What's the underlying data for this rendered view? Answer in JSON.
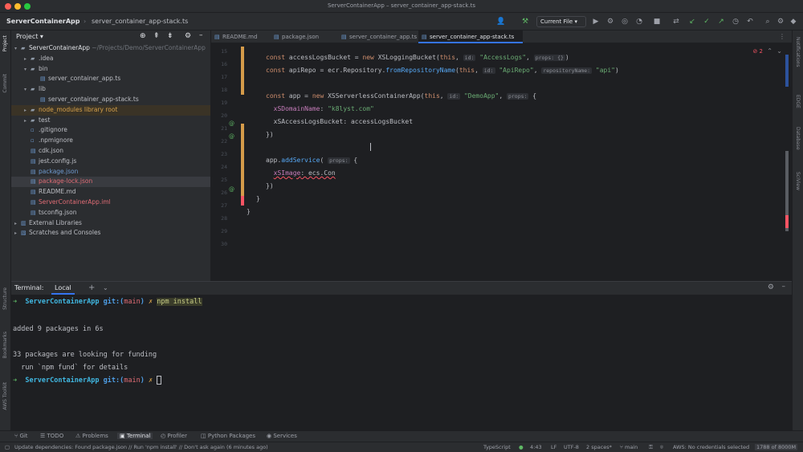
{
  "window": {
    "title": "ServerContainerApp – server_container_app-stack.ts"
  },
  "navbar": {
    "project": "ServerContainerApp",
    "breadcrumb": "server_container_app-stack.ts",
    "run_config": "Current File"
  },
  "project_panel": {
    "title": "Project",
    "items": [
      {
        "label": "ServerContainerApp",
        "suffix": "~/Projects/Demo/ServerContainerApp",
        "indent": 0,
        "arrow": "▾",
        "icon": "folder-icon",
        "color": "#dfe1e5"
      },
      {
        "label": ".idea",
        "indent": 1,
        "arrow": "▸",
        "icon": "folder-icon",
        "color": "#bcbec4"
      },
      {
        "label": "bin",
        "indent": 1,
        "arrow": "▾",
        "icon": "folder-icon",
        "color": "#bcbec4"
      },
      {
        "label": "server_container_app.ts",
        "indent": 2,
        "arrow": "",
        "icon": "ts-file-icon",
        "color": "#bcbec4"
      },
      {
        "label": "lib",
        "indent": 1,
        "arrow": "▾",
        "icon": "folder-icon",
        "color": "#bcbec4"
      },
      {
        "label": "server_container_app-stack.ts",
        "indent": 2,
        "arrow": "",
        "icon": "ts-file-icon",
        "color": "#bcbec4"
      },
      {
        "label": "node_modules  library root",
        "indent": 1,
        "arrow": "▸",
        "icon": "folder-icon",
        "color": "#d5a04a"
      },
      {
        "label": "test",
        "indent": 1,
        "arrow": "▸",
        "icon": "folder-icon",
        "color": "#bcbec4"
      },
      {
        "label": ".gitignore",
        "indent": 1,
        "arrow": "",
        "icon": "file-icon",
        "color": "#bcbec4"
      },
      {
        "label": ".npmignore",
        "indent": 1,
        "arrow": "",
        "icon": "file-icon",
        "color": "#bcbec4"
      },
      {
        "label": "cdk.json",
        "indent": 1,
        "arrow": "",
        "icon": "json-file-icon",
        "color": "#bcbec4"
      },
      {
        "label": "jest.config.js",
        "indent": 1,
        "arrow": "",
        "icon": "js-file-icon",
        "color": "#bcbec4"
      },
      {
        "label": "package.json",
        "indent": 1,
        "arrow": "",
        "icon": "json-file-icon",
        "color": "#6f9bd1"
      },
      {
        "label": "package-lock.json",
        "indent": 1,
        "arrow": "",
        "icon": "json-file-icon",
        "color": "#e06c75"
      },
      {
        "label": "README.md",
        "indent": 1,
        "arrow": "",
        "icon": "md-file-icon",
        "color": "#bcbec4"
      },
      {
        "label": "ServerContainerApp.iml",
        "indent": 1,
        "arrow": "",
        "icon": "iml-file-icon",
        "color": "#e06c75"
      },
      {
        "label": "tsconfig.json",
        "indent": 1,
        "arrow": "",
        "icon": "json-file-icon",
        "color": "#bcbec4"
      },
      {
        "label": "External Libraries",
        "indent": 0,
        "arrow": "▸",
        "icon": "library-icon",
        "color": "#bcbec4"
      },
      {
        "label": "Scratches and Consoles",
        "indent": 0,
        "arrow": "▸",
        "icon": "scratch-icon",
        "color": "#bcbec4"
      }
    ]
  },
  "editor": {
    "tabs": [
      {
        "label": "README.md",
        "active": false
      },
      {
        "label": "package.json",
        "active": false
      },
      {
        "label": "server_container_app.ts",
        "active": false
      },
      {
        "label": "server_container_app-stack.ts",
        "active": true
      }
    ],
    "line_numbers": [
      "15",
      "16",
      "17",
      "18",
      "19",
      "20",
      "21",
      "22",
      "23",
      "24",
      "25",
      "26",
      "27",
      "28",
      "29",
      "30"
    ],
    "problems": "2"
  },
  "terminal": {
    "title": "Terminal:",
    "tab": "Local",
    "prompt_path": "ServerContainerApp",
    "prompt_git": "git:(",
    "prompt_branch": "main",
    "prompt_git_close": ")",
    "prompt_x": "✗",
    "command": "npm install",
    "out1": "added 9 packages in 6s",
    "out2": "33 packages are looking for funding",
    "out3": "  run `npm fund` for details"
  },
  "bottom_tools": [
    {
      "label": "Git",
      "icon": "branch-icon"
    },
    {
      "label": "TODO",
      "icon": "list-icon"
    },
    {
      "label": "Problems",
      "icon": "warning-icon"
    },
    {
      "label": "Terminal",
      "icon": "terminal-icon",
      "active": true
    },
    {
      "label": "Profiler",
      "icon": "profiler-icon"
    },
    {
      "label": "Python Packages",
      "icon": "package-icon"
    },
    {
      "label": "Services",
      "icon": "services-icon"
    }
  ],
  "status": {
    "message": "Update dependencies: Found package.json // Run 'npm install'  // Don't ask again (6 minutes ago)",
    "lang": "TypeScript",
    "position": "4:43",
    "line_sep": "LF",
    "encoding": "UTF-8",
    "indent": "2 spaces*",
    "branch": "main",
    "aws": "AWS: No credentials selected",
    "memory": "1788 of 8000M"
  },
  "colors": {
    "accent": "#3574f0",
    "bg": "#1e1f22",
    "panel": "#2b2d30"
  }
}
